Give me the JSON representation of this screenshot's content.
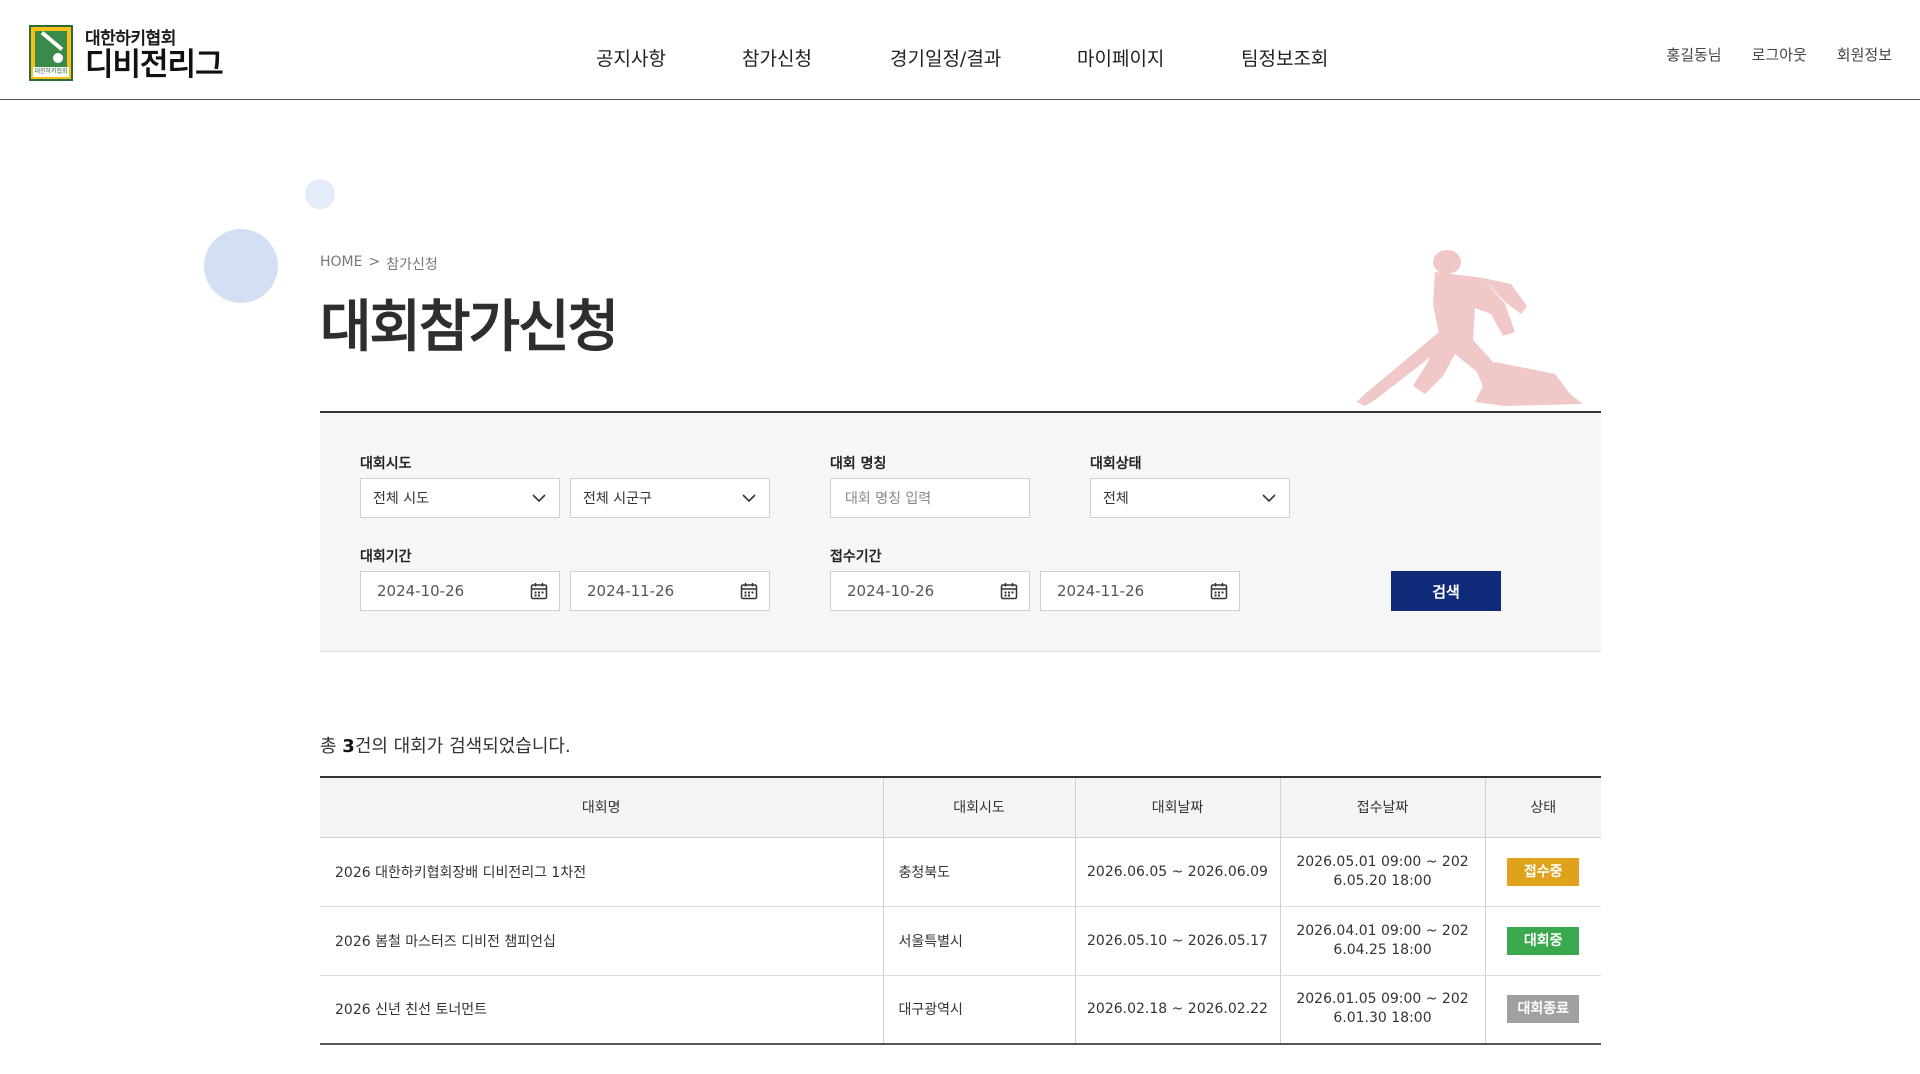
{
  "header": {
    "logo_small": "대한하키협회",
    "logo_big": "디비전리그",
    "logo_badge_caption": "대한하키협회",
    "nav": [
      "공지사항",
      "참가신청",
      "경기일정/결과",
      "마이페이지",
      "팀정보조회"
    ],
    "util": [
      "홍길동님",
      "로그아웃",
      "회원정보"
    ]
  },
  "breadcrumb": {
    "home": "HOME",
    "sep": ">",
    "current": "참가신청"
  },
  "page_title": "대회참가신청",
  "search": {
    "region_label": "대회시도",
    "sido_value": "전체 시도",
    "sigungu_value": "전체 시군구",
    "name_label": "대회 명칭",
    "name_placeholder": "대회 명칭 입력",
    "status_label": "대회상태",
    "status_value": "전체",
    "period_label": "대회기간",
    "period_start": "2024-10-26",
    "period_end": "2024-11-26",
    "receipt_label": "접수기간",
    "receipt_start": "2024-10-26",
    "receipt_end": "2024-11-26",
    "button": "검색"
  },
  "result": {
    "prefix": "총 ",
    "count": "3",
    "suffix": "건의 대회가 검색되었습니다."
  },
  "table": {
    "headers": [
      "대회명",
      "대회시도",
      "대회날짜",
      "접수날짜",
      "상태"
    ],
    "rows": [
      {
        "name": "2026 대한하키협회장배 디비전리그 1차전",
        "region": "충청북도",
        "date": "2026.06.05 ~ 2026.06.09",
        "recv1": "2026.05.01 09:00 ~ 202",
        "recv2": "6.05.20 18:00",
        "status": "접수중"
      },
      {
        "name": "2026 봄철 마스터즈 디비전 챔피언십",
        "region": "서울특별시",
        "date": "2026.05.10 ~ 2026.05.17",
        "recv1": "2026.04.01 09:00 ~ 202",
        "recv2": "6.04.25 18:00",
        "status": "대회중"
      },
      {
        "name": "2026 신년 친선 토너먼트",
        "region": "대구광역시",
        "date": "2026.02.18 ~ 2026.02.22",
        "recv1": "2026.01.05 09:00 ~ 202",
        "recv2": "6.01.30 18:00",
        "status": "대회종료"
      }
    ]
  },
  "colors": {
    "primary": "#0f2a78",
    "status_receiving": "#e0a11b",
    "status_ongoing": "#3aa84d",
    "status_closed": "#a0a0a0",
    "player_silhouette": "#f0c8c8"
  },
  "icons": {
    "chevron": "chevron-down-icon",
    "calendar": "calendar-icon"
  }
}
